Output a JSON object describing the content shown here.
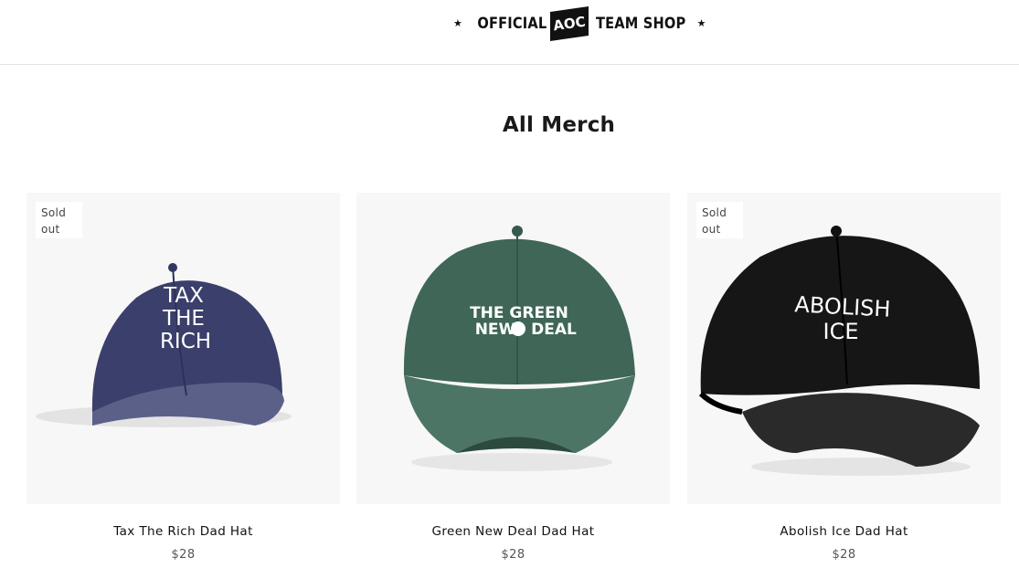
{
  "header": {
    "logo": {
      "left_word": "OFFICIAL",
      "badge_text": "AOC",
      "right_word": "TEAM SHOP",
      "star": "★"
    }
  },
  "page": {
    "title": "All Merch"
  },
  "products": [
    {
      "name": "Tax The Rich Dad Hat",
      "price": "$28",
      "badge_line1": "Sold",
      "badge_line2": "out",
      "hat_text": [
        "TAX",
        "THE",
        "RICH"
      ],
      "hat_color": "#3b3f6b"
    },
    {
      "name": "Green New Deal Dad Hat",
      "price": "$28",
      "hat_text": [
        "THE GREEN",
        "NEW",
        "DEAL"
      ],
      "hat_color": "#3f6657"
    },
    {
      "name": "Abolish Ice Dad Hat",
      "price": "$28",
      "badge_line1": "Sold",
      "badge_line2": "out",
      "hat_text": [
        "ABOLISH",
        "ICE"
      ],
      "hat_color": "#111111"
    }
  ]
}
